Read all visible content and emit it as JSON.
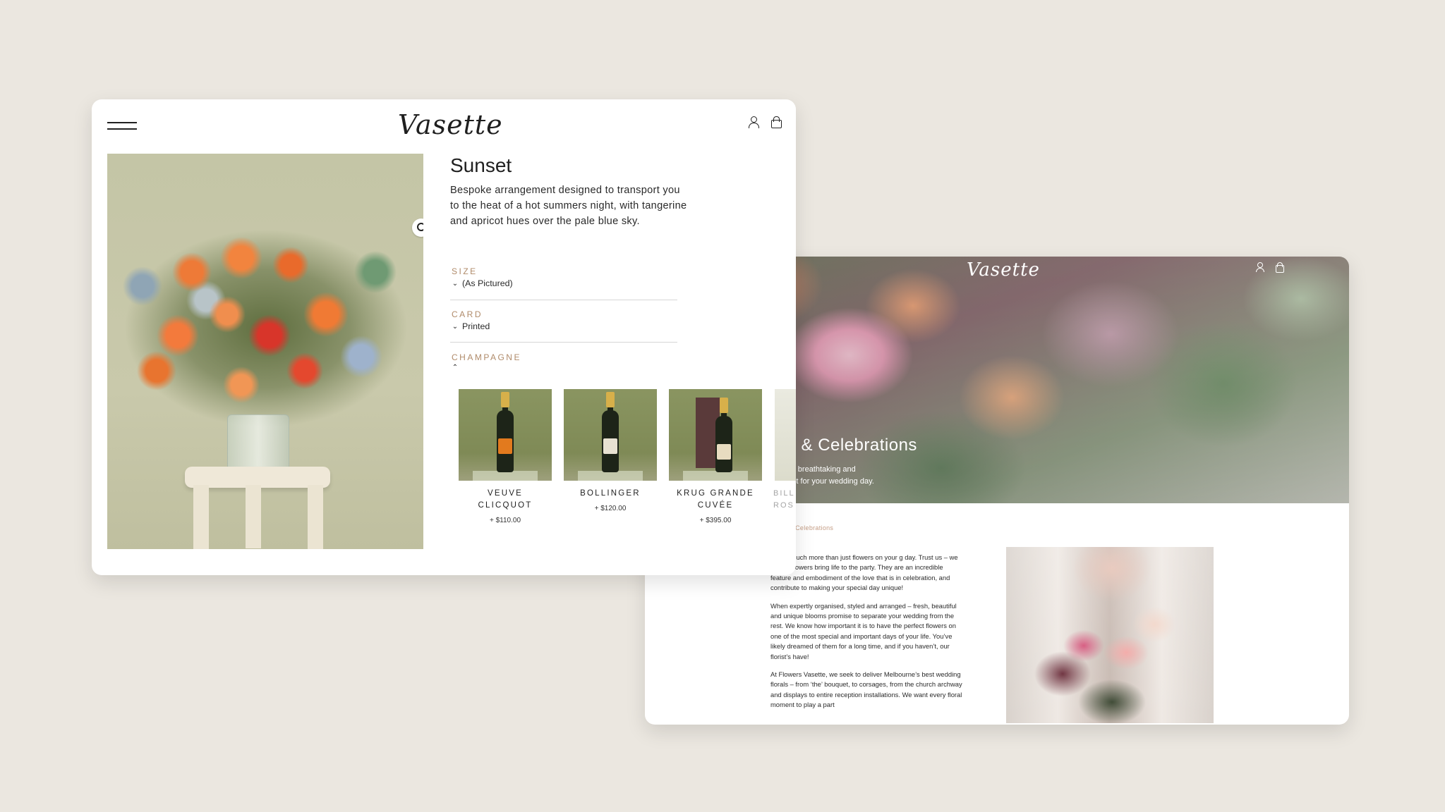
{
  "colors": {
    "background": "#ebe7e0",
    "accent_label": "#b08b6a",
    "crumb": "#c59e86"
  },
  "weddings_page": {
    "logo": "Vasette",
    "icons": [
      "user-icon",
      "bag-icon"
    ],
    "hero_title": "gs & Celebrations",
    "hero_sub_line1": "ting breathtaking and",
    "hero_sub_line2": "rfect for your wedding day.",
    "breadcrumb": "& Celebrations",
    "paragraphs": [
      "are so much more than just flowers on your g day. Trust us – we know! Flowers bring life to the party. They are an incredible feature and embodiment of the love that is in celebration, and contribute to making your special day unique!",
      "When expertly organised, styled and arranged – fresh, beautiful and unique blooms promise to separate your wedding from the rest. We know how important it is to have the perfect flowers on one of the most special and important days of your life. You’ve likely dreamed of them for a long time, and if you haven’t, our florist’s have!",
      "At Flowers Vasette, we seek to deliver Melbourne’s best wedding florals – from ‘the’ bouquet, to corsages, from the church archway and displays to entire reception installations. We want every floral moment to play a part"
    ]
  },
  "product_page": {
    "logo": "Vasette",
    "menu_icon": "hamburger-icon",
    "icons": [
      "user-icon",
      "bag-icon"
    ],
    "zoom_icon": "magnifier-icon",
    "title": "Sunset",
    "description": "Bespoke arrangement designed to transport you to the heat of a hot summers night, with tangerine and apricot hues over the pale blue sky.",
    "options": [
      {
        "label": "SIZE",
        "value": "(As Pictured)"
      },
      {
        "label": "CARD",
        "value": "Printed"
      },
      {
        "label": "CHAMPAGNE",
        "value": ""
      }
    ],
    "champagnes": [
      {
        "name": "VEUVE CLICQUOT",
        "price": "+ $110.00",
        "label_color": "#e27a1e"
      },
      {
        "name": "BOLLINGER",
        "price": "+ $120.00",
        "label_color": "#e8e2d2"
      },
      {
        "name": "KRUG GRANDE CUVÉE",
        "price": "+ $395.00",
        "label_color": "#e8dcc0"
      }
    ],
    "partial_item": "BILL ROS"
  }
}
